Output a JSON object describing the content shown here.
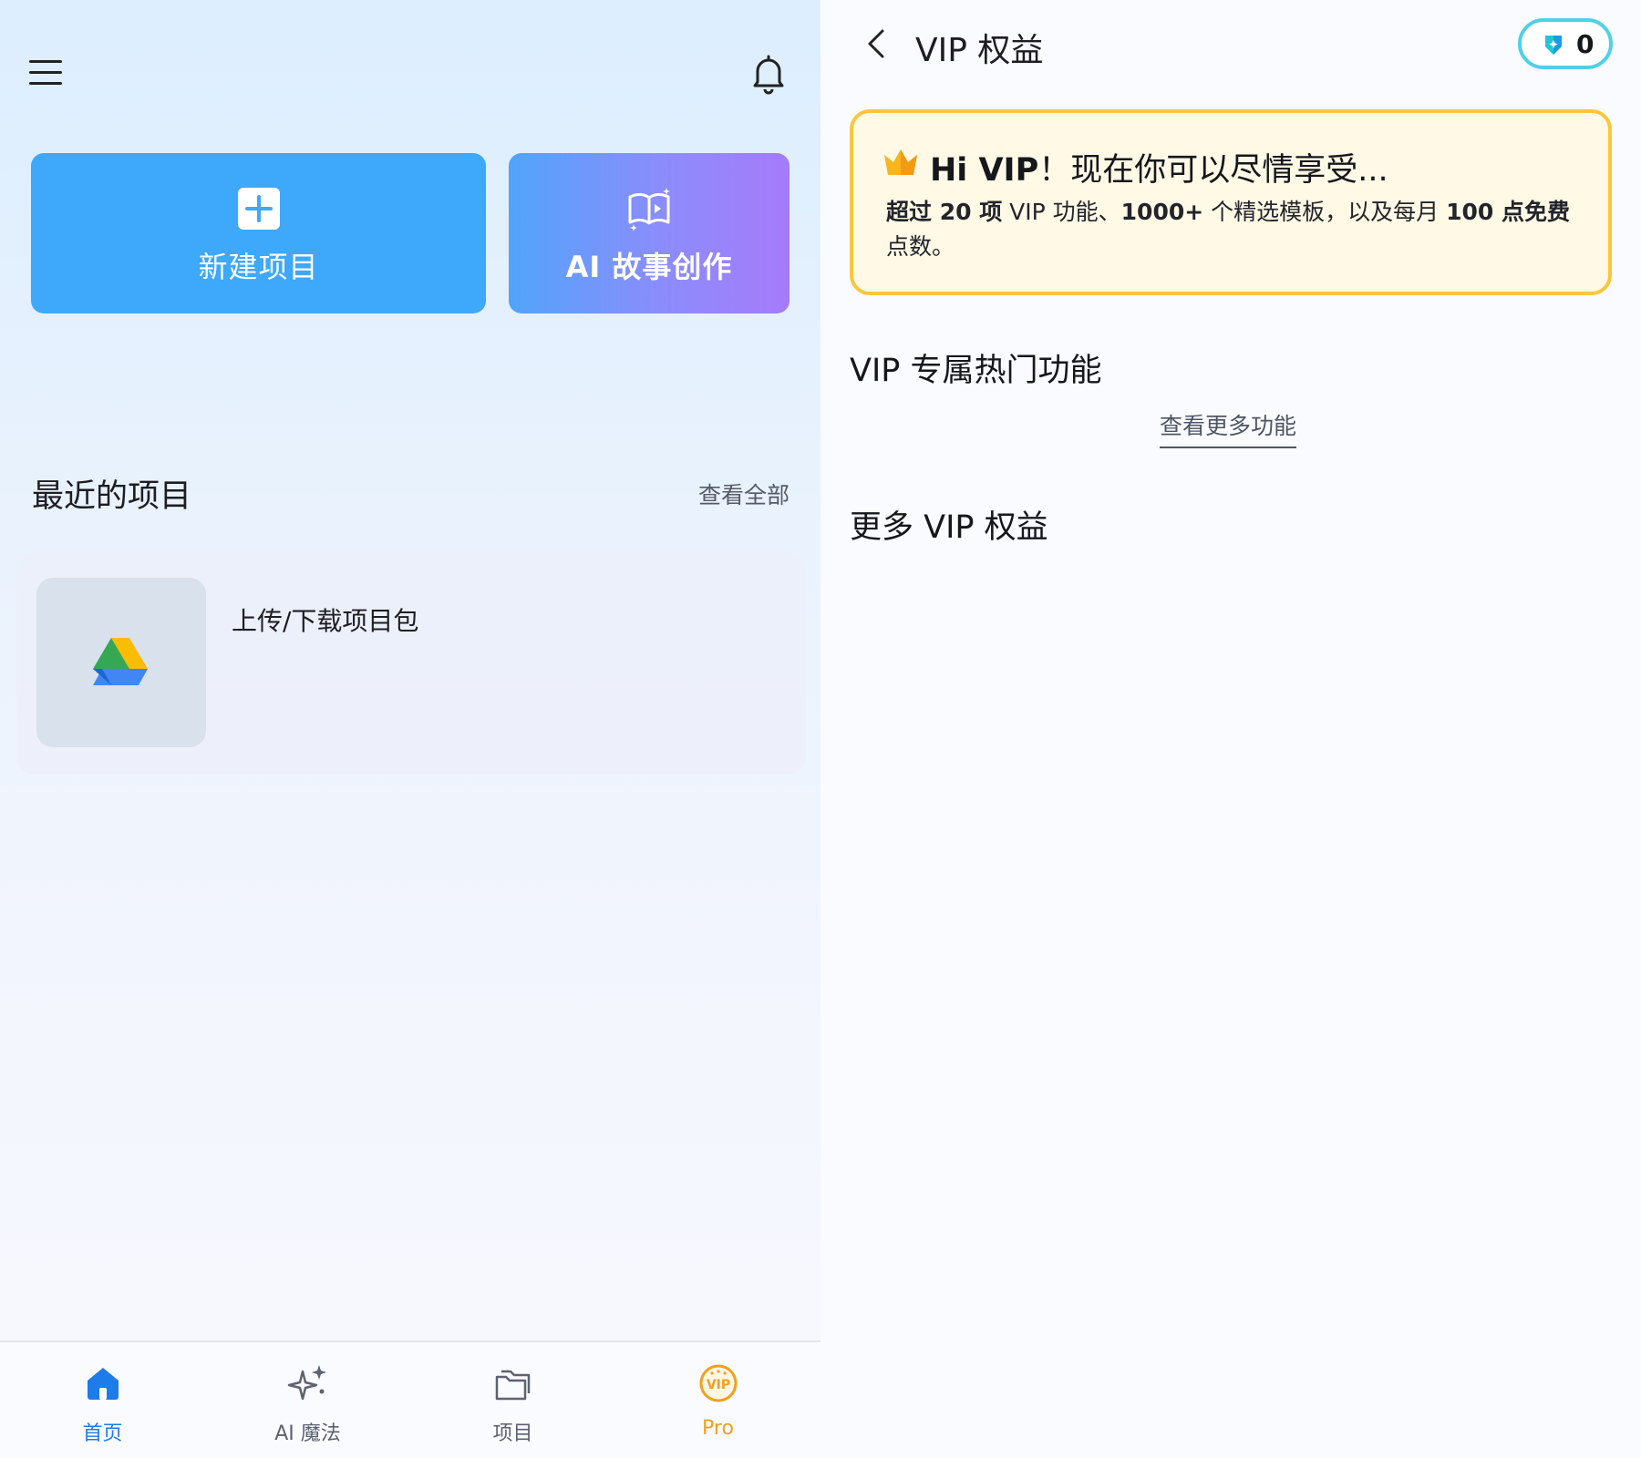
{
  "left": {
    "card_new_label": "新建项目",
    "card_ai_label": "AI 故事创作",
    "recent_title": "最近的项目",
    "view_all": "查看全部",
    "project_name": "上传/下载项目包",
    "nav": [
      {
        "label": "首页",
        "icon": "home-icon"
      },
      {
        "label": "AI 魔法",
        "icon": "sparkle-icon"
      },
      {
        "label": "项目",
        "icon": "folder-icon"
      },
      {
        "label": "Pro",
        "icon": "vip-icon"
      }
    ]
  },
  "right": {
    "page_title": "VIP 权益",
    "coin_count": "0",
    "banner": {
      "title_strong": "Hi VIP",
      "title_rest": "！现在你可以尽情享受...",
      "d1": "超过 20 项",
      "d2": " VIP 功能、",
      "d3": "1000+",
      "d4": " 个精选模板，以及每月 ",
      "d5": "100 点免费",
      "d6": "点数。"
    },
    "section_hot": "VIP 专属热门功能",
    "see_more": "查看更多功能",
    "section_more": "更多 VIP 权益"
  },
  "colors": {
    "accent_blue": "#3ea8fb",
    "nav_active": "#1e7bea",
    "pro_orange": "#f0a020",
    "banner_border": "#f9c63e",
    "coin_border": "#4fd0e6"
  }
}
